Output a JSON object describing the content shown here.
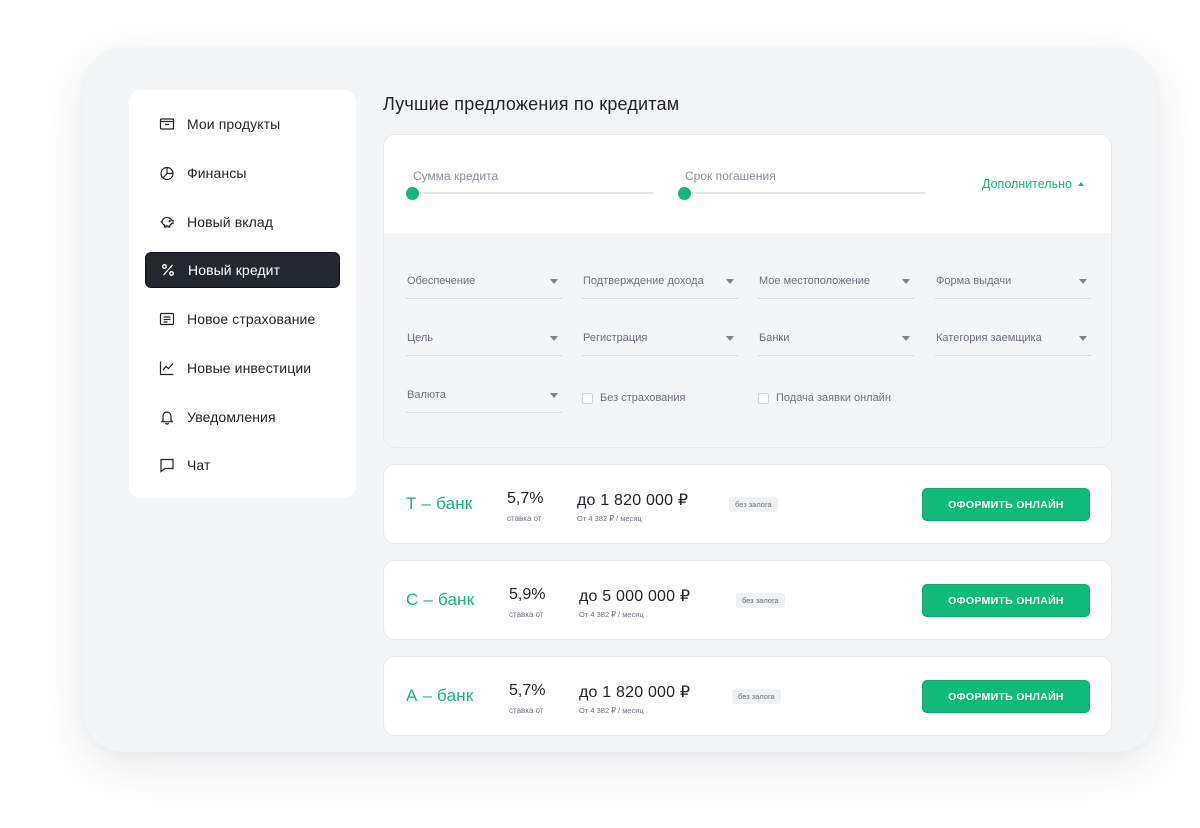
{
  "sidebar": {
    "items": [
      {
        "label": "Мои продукты",
        "icon": "wallet-icon"
      },
      {
        "label": "Финансы",
        "icon": "pie-chart-icon"
      },
      {
        "label": "Новый вклад",
        "icon": "piggy-bank-icon"
      },
      {
        "label": "Новый кредит",
        "icon": "percent-icon",
        "active": true
      },
      {
        "label": "Новое страхование",
        "icon": "document-icon"
      },
      {
        "label": "Новые инвестиции",
        "icon": "trend-chart-icon"
      },
      {
        "label": "Уведомления",
        "icon": "bell-icon"
      },
      {
        "label": "Чат",
        "icon": "chat-icon"
      }
    ]
  },
  "main": {
    "title": "Лучшие предложения по кредитам",
    "sliders": {
      "amount_label": "Сумма кредита",
      "term_label": "Срок погашения",
      "amount_level": 0,
      "term_level": 0
    },
    "more_link": "Дополнительно",
    "filters": {
      "selects": [
        "Обеспечение",
        "Подтверждение дохода",
        "Мое местоположение",
        "Форма выдачи",
        "Цель",
        "Регистрация",
        "Банки",
        "Категория заемщика",
        "Валюта"
      ],
      "checkboxes": [
        {
          "label": "Без страхования",
          "checked": false
        },
        {
          "label": "Подача заявки онлайн",
          "checked": false
        }
      ]
    },
    "offers": [
      {
        "bank": "Т – банк",
        "rate": "5,7%",
        "rate_caption": "ставка от",
        "amount": "до 1 820 000 ₽",
        "monthly": "От 4 382 ₽ / месяц",
        "tag": "без залога",
        "button": "ОФОРМИТЬ ОНЛАЙН"
      },
      {
        "bank": "С – банк",
        "rate": "5,9%",
        "rate_caption": "ставка от",
        "amount": "до 5 000 000 ₽",
        "monthly": "От 4 382 ₽ / месяц",
        "tag": "без залога",
        "button": "ОФОРМИТЬ ОНЛАЙН"
      },
      {
        "bank": "А – банк",
        "rate": "5,7%",
        "rate_caption": "ставка от",
        "amount": "до 1 820 000 ₽",
        "monthly": "От 4 382 ₽ / месяц",
        "tag": "без залога",
        "button": "ОФОРМИТЬ ОНЛАЙН"
      }
    ]
  },
  "colors": {
    "accent": "#14b57a",
    "active_nav_bg": "#23272e",
    "background": "#f4f5f7"
  }
}
